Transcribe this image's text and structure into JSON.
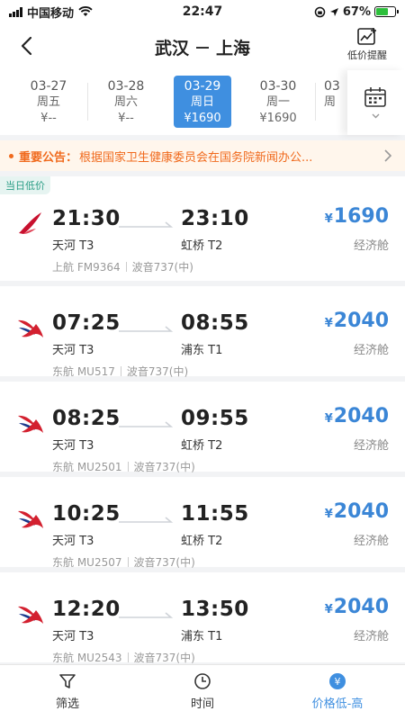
{
  "status": {
    "carrier": "中国移动",
    "time": "22:47",
    "battery": "67%",
    "battery_level": 0.67
  },
  "header": {
    "origin": "武汉",
    "destination": "上海",
    "alert_label": "低价提醒"
  },
  "dates": [
    {
      "date": "03-27",
      "weekday": "周五",
      "price": "¥--"
    },
    {
      "date": "03-28",
      "weekday": "周六",
      "price": "¥--"
    },
    {
      "date": "03-29",
      "weekday": "周日",
      "price": "¥1690"
    },
    {
      "date": "03-30",
      "weekday": "周一",
      "price": "¥1690"
    },
    {
      "date": "03",
      "weekday": "周",
      "price": ""
    }
  ],
  "notice": {
    "title": "重要公告：",
    "text": "根据国家卫生健康委员会在国务院新闻办公..."
  },
  "badge": "当日低价",
  "currency": "¥",
  "flights": [
    {
      "airline_logo": "shanghai-airlines-logo",
      "dep_time": "21:30",
      "arr_time": "23:10",
      "dep_airport": "天河 T3",
      "arr_airport": "虹桥 T2",
      "price": "1690",
      "cabin": "经济舱",
      "flight_no": "上航 FM9364",
      "aircraft": "波音737(中)"
    },
    {
      "airline_logo": "china-eastern-logo",
      "dep_time": "07:25",
      "arr_time": "08:55",
      "dep_airport": "天河 T3",
      "arr_airport": "浦东 T1",
      "price": "2040",
      "cabin": "经济舱",
      "flight_no": "东航 MU517",
      "aircraft": "波音737(中)"
    },
    {
      "airline_logo": "china-eastern-logo",
      "dep_time": "08:25",
      "arr_time": "09:55",
      "dep_airport": "天河 T3",
      "arr_airport": "虹桥 T2",
      "price": "2040",
      "cabin": "经济舱",
      "flight_no": "东航 MU2501",
      "aircraft": "波音737(中)"
    },
    {
      "airline_logo": "china-eastern-logo",
      "dep_time": "10:25",
      "arr_time": "11:55",
      "dep_airport": "天河 T3",
      "arr_airport": "虹桥 T2",
      "price": "2040",
      "cabin": "经济舱",
      "flight_no": "东航 MU2507",
      "aircraft": "波音737(中)"
    },
    {
      "airline_logo": "china-eastern-logo",
      "dep_time": "12:20",
      "arr_time": "13:50",
      "dep_airport": "天河 T3",
      "arr_airport": "浦东 T1",
      "price": "2040",
      "cabin": "经济舱",
      "flight_no": "东航 MU2543",
      "aircraft": "波音737(中)"
    }
  ],
  "bottom_tabs": [
    {
      "label": "筛选",
      "icon": "filter-icon"
    },
    {
      "label": "时间",
      "icon": "clock-icon"
    },
    {
      "label": "价格低-高",
      "icon": "yuan-icon",
      "active": true
    }
  ],
  "colors": {
    "accent": "#3f8fe0",
    "price": "#3b86d6",
    "notice": "#f06a1d",
    "eastern_red": "#d3202f",
    "eastern_blue": "#1b3a8c"
  }
}
